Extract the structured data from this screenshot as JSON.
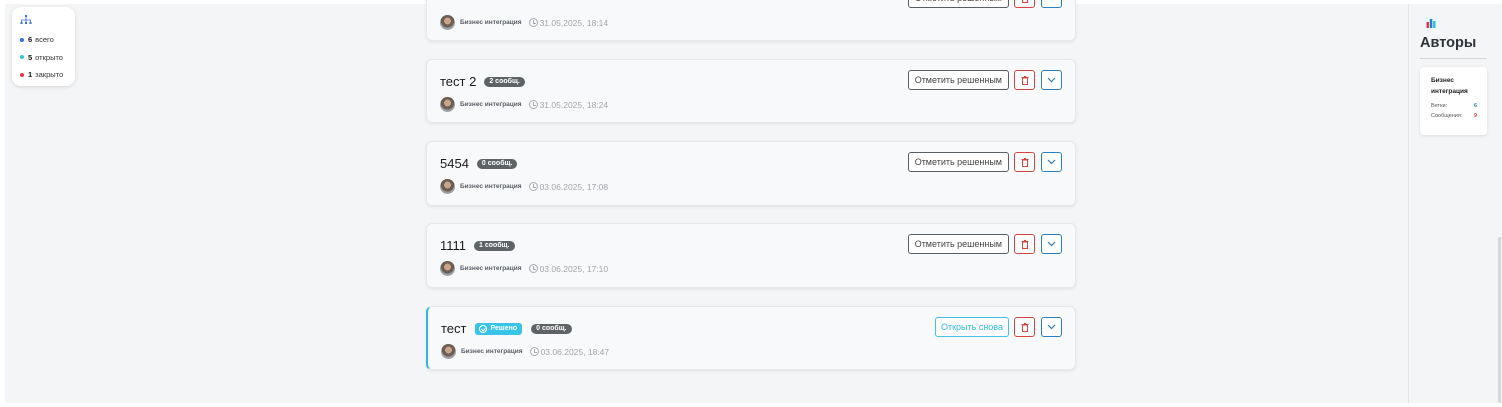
{
  "stats": {
    "items": [
      {
        "count": "6",
        "label": "всего",
        "color": "#3b6fd8"
      },
      {
        "count": "5",
        "label": "открыто",
        "color": "#2fc4d8"
      },
      {
        "count": "1",
        "label": "закрыто",
        "color": "#e0394b"
      }
    ]
  },
  "threads": [
    {
      "title": "",
      "count_badge": "",
      "author": "Бизнес интеграция",
      "date": "31.05.2025, 18:14",
      "action_label": "Отметить решенным",
      "resolved": false
    },
    {
      "title": "тест 2",
      "count_badge": "2 сообщ.",
      "author": "Бизнес интеграция",
      "date": "31.05.2025, 18:24",
      "action_label": "Отметить решенным",
      "resolved": false
    },
    {
      "title": "5454",
      "count_badge": "0 сообщ.",
      "author": "Бизнес интеграция",
      "date": "03.06.2025, 17:08",
      "action_label": "Отметить решенным",
      "resolved": false
    },
    {
      "title": "1111",
      "count_badge": "1 сообщ.",
      "author": "Бизнес интеграция",
      "date": "03.06.2025, 17:10",
      "action_label": "Отметить решенным",
      "resolved": false
    },
    {
      "title": "тест",
      "resolved_badge": "Решено",
      "count_badge": "0 сообщ.",
      "author": "Бизнес интеграция",
      "date": "03.06.2025, 18:47",
      "action_label": "Открыть снова",
      "resolved": true
    }
  ],
  "authors": {
    "title": "Авторы",
    "items": [
      {
        "name": "Бизнес интеграция",
        "branches_label": "Ветки:",
        "branches": "6",
        "messages_label": "Сообщения:",
        "messages": "9"
      }
    ]
  },
  "colors": {
    "accent": "#2fb7e6",
    "danger": "#d9433f",
    "primary": "#2b7fc0"
  }
}
